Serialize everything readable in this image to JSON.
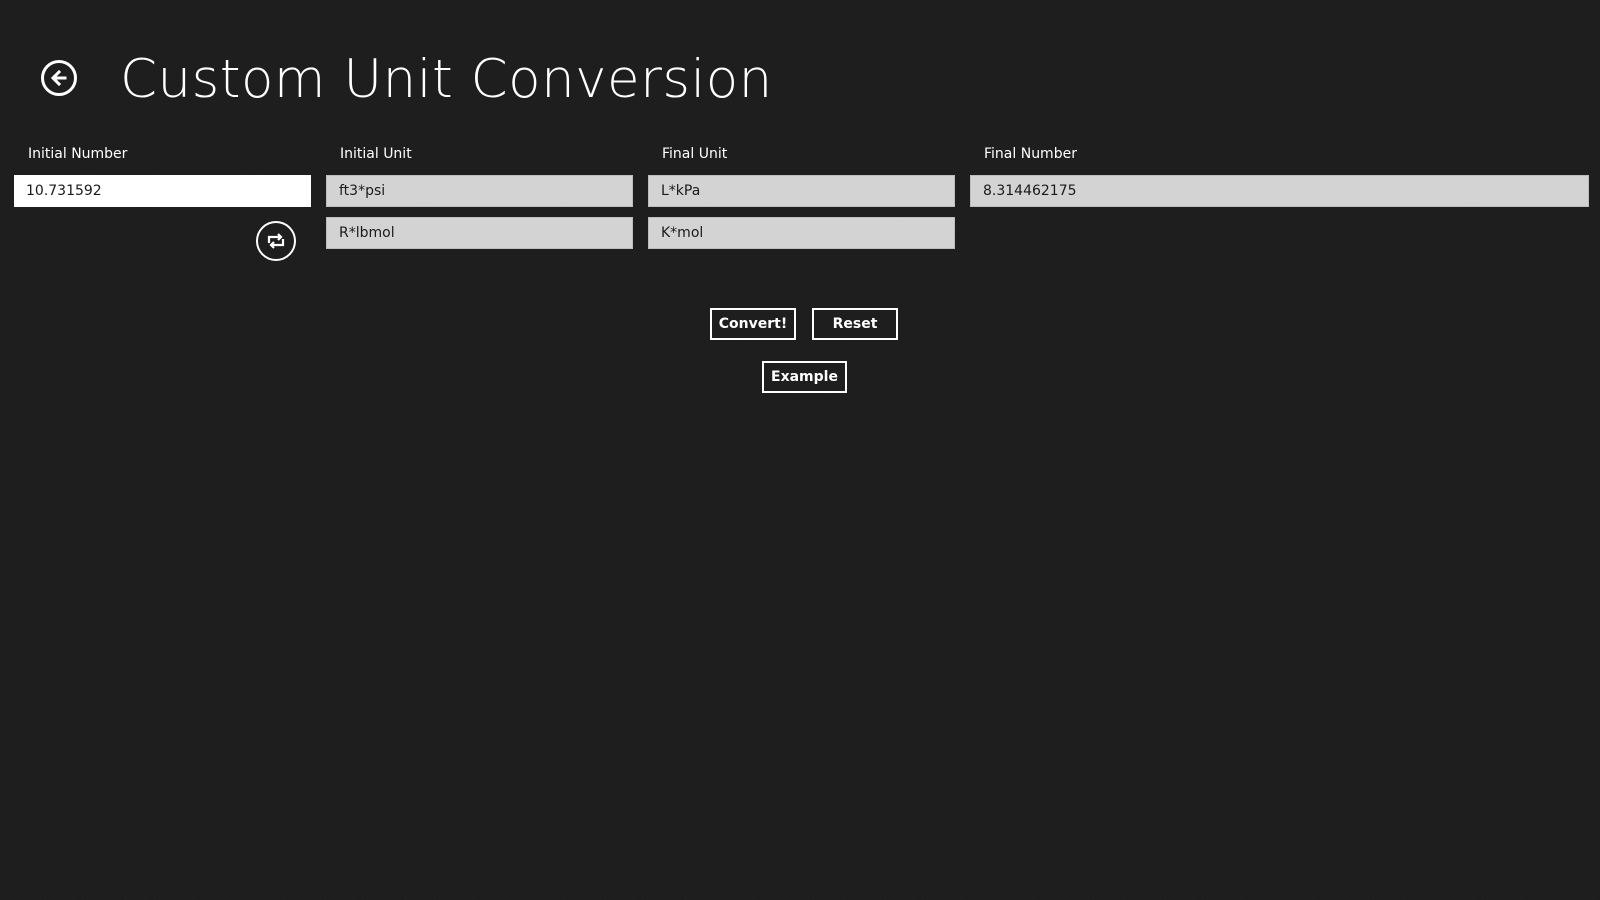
{
  "header": {
    "title": "Custom Unit Conversion",
    "back_icon": "back-arrow-circle-icon"
  },
  "labels": {
    "initial_number": "Initial Number",
    "initial_unit": "Initial Unit",
    "final_unit": "Final Unit",
    "final_number": "Final Number"
  },
  "fields": {
    "initial_number": "10.731592",
    "initial_unit_1": "ft3*psi",
    "initial_unit_2": "R*lbmol",
    "final_unit_1": "L*kPa",
    "final_unit_2": "K*mol",
    "final_number": "8.314462175"
  },
  "swap_icon": "swap-arrows-icon",
  "buttons": {
    "convert": "Convert!",
    "reset": "Reset",
    "example": "Example"
  },
  "colors": {
    "background": "#1d1d1d",
    "text": "#ffffff",
    "field_background": "#d3d3d3",
    "active_field_background": "#ffffff"
  }
}
